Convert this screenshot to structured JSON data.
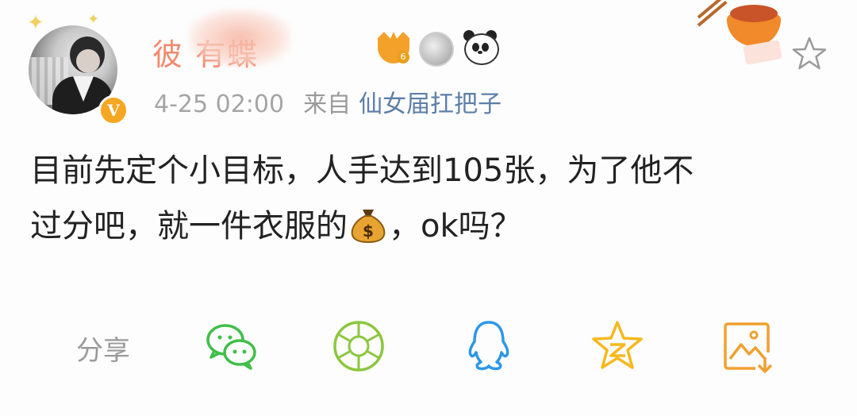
{
  "post": {
    "username": "彼    有蝶",
    "vip_level": "6",
    "vip_badge_text": "V",
    "timestamp": "4-25 02:00",
    "source_prefix": "来自",
    "source_name": "仙女届扛把子",
    "content_line1": "目前先定个小目标，人手达到105张，为了他不",
    "content_line2_a": "过分吧，就一件衣服的",
    "content_line2_b": "，ok吗？"
  },
  "share": {
    "label": "分享",
    "targets": [
      "wechat-icon",
      "moments-icon",
      "qq-icon",
      "qzone-icon",
      "save-image-icon"
    ]
  },
  "colors": {
    "username": "#f28a6e",
    "source_link": "#5d7fa8",
    "wechat_green": "#3fbf47",
    "qq_blue": "#2c97e8",
    "qzone_yellow": "#f5b81e",
    "save_orange": "#f0a030"
  }
}
